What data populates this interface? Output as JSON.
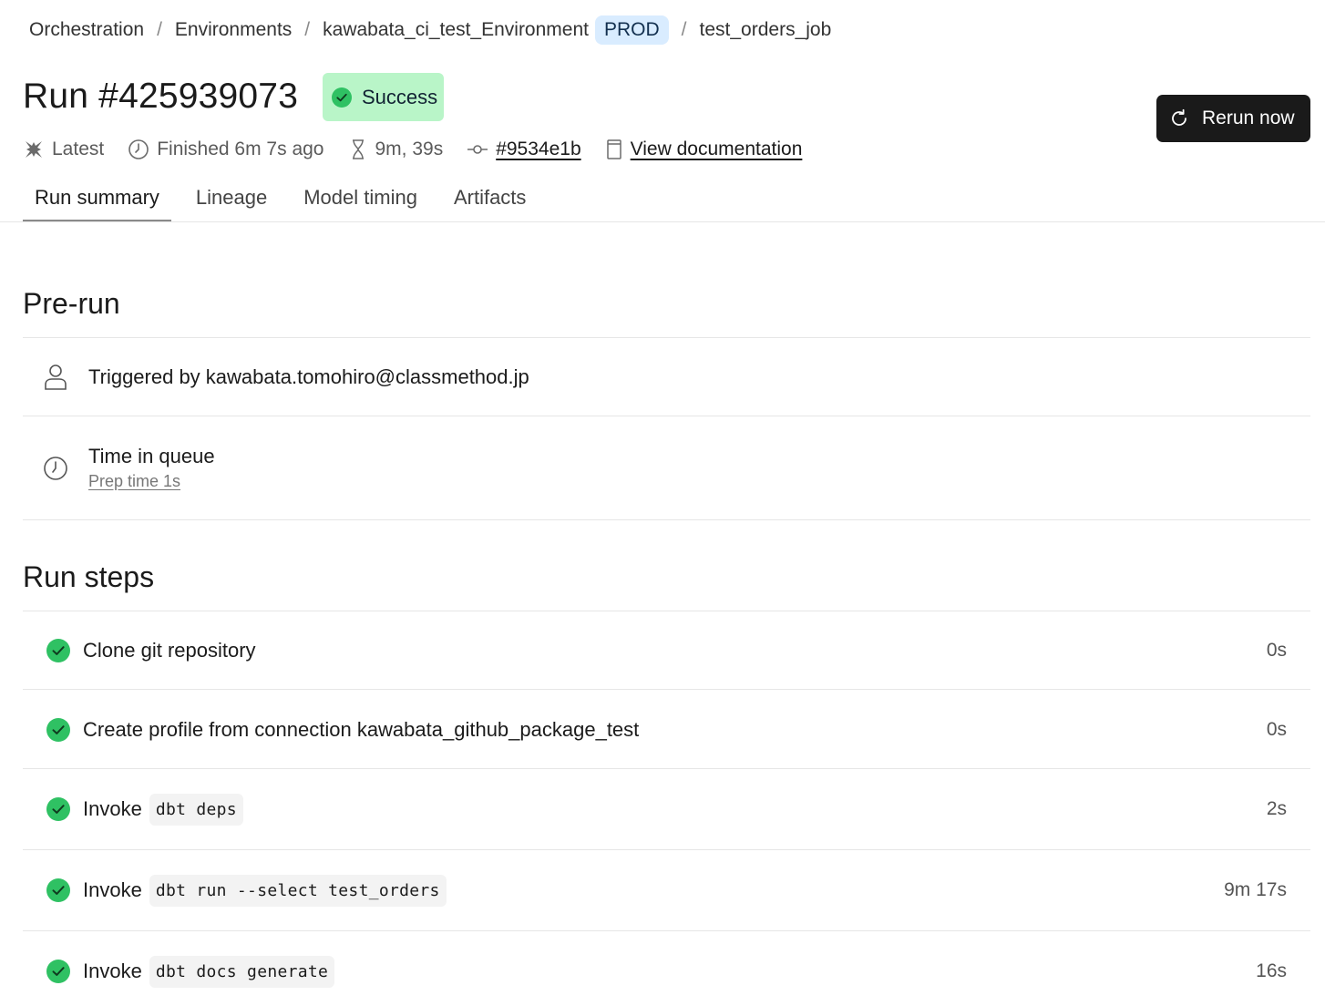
{
  "breadcrumb": {
    "items": [
      "Orchestration",
      "Environments",
      "kawabata_ci_test_Environment"
    ],
    "env_badge": "PROD",
    "current": "test_orders_job",
    "separator": "/"
  },
  "run": {
    "title": "Run #425939073",
    "status": "Success",
    "status_color": "#b9f5c8",
    "rerun_label": "Rerun now"
  },
  "meta": {
    "latest": "Latest",
    "finished": "Finished 6m 7s ago",
    "duration": "9m, 39s",
    "commit": "#9534e1b",
    "docs": "View documentation"
  },
  "tabs": [
    "Run summary",
    "Lineage",
    "Model timing",
    "Artifacts"
  ],
  "prerun": {
    "title": "Pre-run",
    "triggered": "Triggered by kawabata.tomohiro@classmethod.jp",
    "queue_label": "Time in queue",
    "prep_time": "Prep time 1s"
  },
  "run_steps": {
    "title": "Run steps",
    "steps": [
      {
        "label": "Clone git repository",
        "code": "",
        "duration": "0s"
      },
      {
        "label": "Create profile from connection kawabata_github_package_test",
        "code": "",
        "duration": "0s"
      },
      {
        "label": "Invoke",
        "code": "dbt deps",
        "duration": "2s"
      },
      {
        "label": "Invoke",
        "code": "dbt run --select test_orders",
        "duration": "9m 17s"
      },
      {
        "label": "Invoke",
        "code": "dbt docs generate",
        "duration": "16s"
      }
    ]
  },
  "colors": {
    "success_green": "#2fc163",
    "env_badge_bg": "#d9ecff",
    "button_bg": "#1a1a1a"
  }
}
